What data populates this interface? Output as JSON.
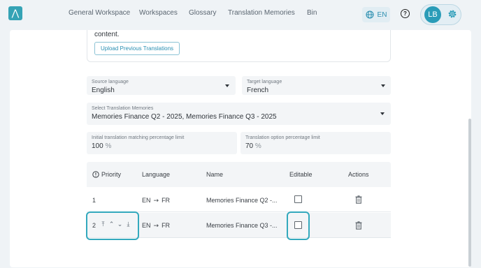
{
  "header": {
    "logo_glyph": "⋀",
    "nav": [
      "General Workspace",
      "Workspaces",
      "Glossary",
      "Translation Memories",
      "Bin"
    ],
    "lang_label": "EN",
    "help_glyph": "?",
    "avatar_initials": "LB"
  },
  "card": {
    "text": "content.",
    "upload_label": "Upload Previous Translations"
  },
  "form": {
    "source_label": "Source language",
    "source_value": "English",
    "target_label": "Target language",
    "target_value": "French",
    "tm_label": "Select Translation Memories",
    "tm_value": "Memories Finance Q2 - 2025, Memories Finance Q3 - 2025",
    "initial_label": "Initial translation matching percentage limit",
    "initial_value": "100",
    "option_label": "Translation option percentage limit",
    "option_value": "70",
    "percent": "%"
  },
  "table": {
    "headers": {
      "priority": "Priority",
      "language": "Language",
      "name": "Name",
      "editable": "Editable",
      "actions": "Actions"
    },
    "rows": [
      {
        "priority": "1",
        "lang_from": "EN",
        "lang_to": "FR",
        "arrow": "→",
        "name": "Memories Finance Q2 -...",
        "editable": false
      },
      {
        "priority": "2",
        "lang_from": "EN",
        "lang_to": "FR",
        "arrow": "→",
        "name": "Memories Finance Q3 -...",
        "editable": false
      }
    ]
  },
  "colors": {
    "accent": "#2a9cb8",
    "highlight": "#33a9bd"
  }
}
